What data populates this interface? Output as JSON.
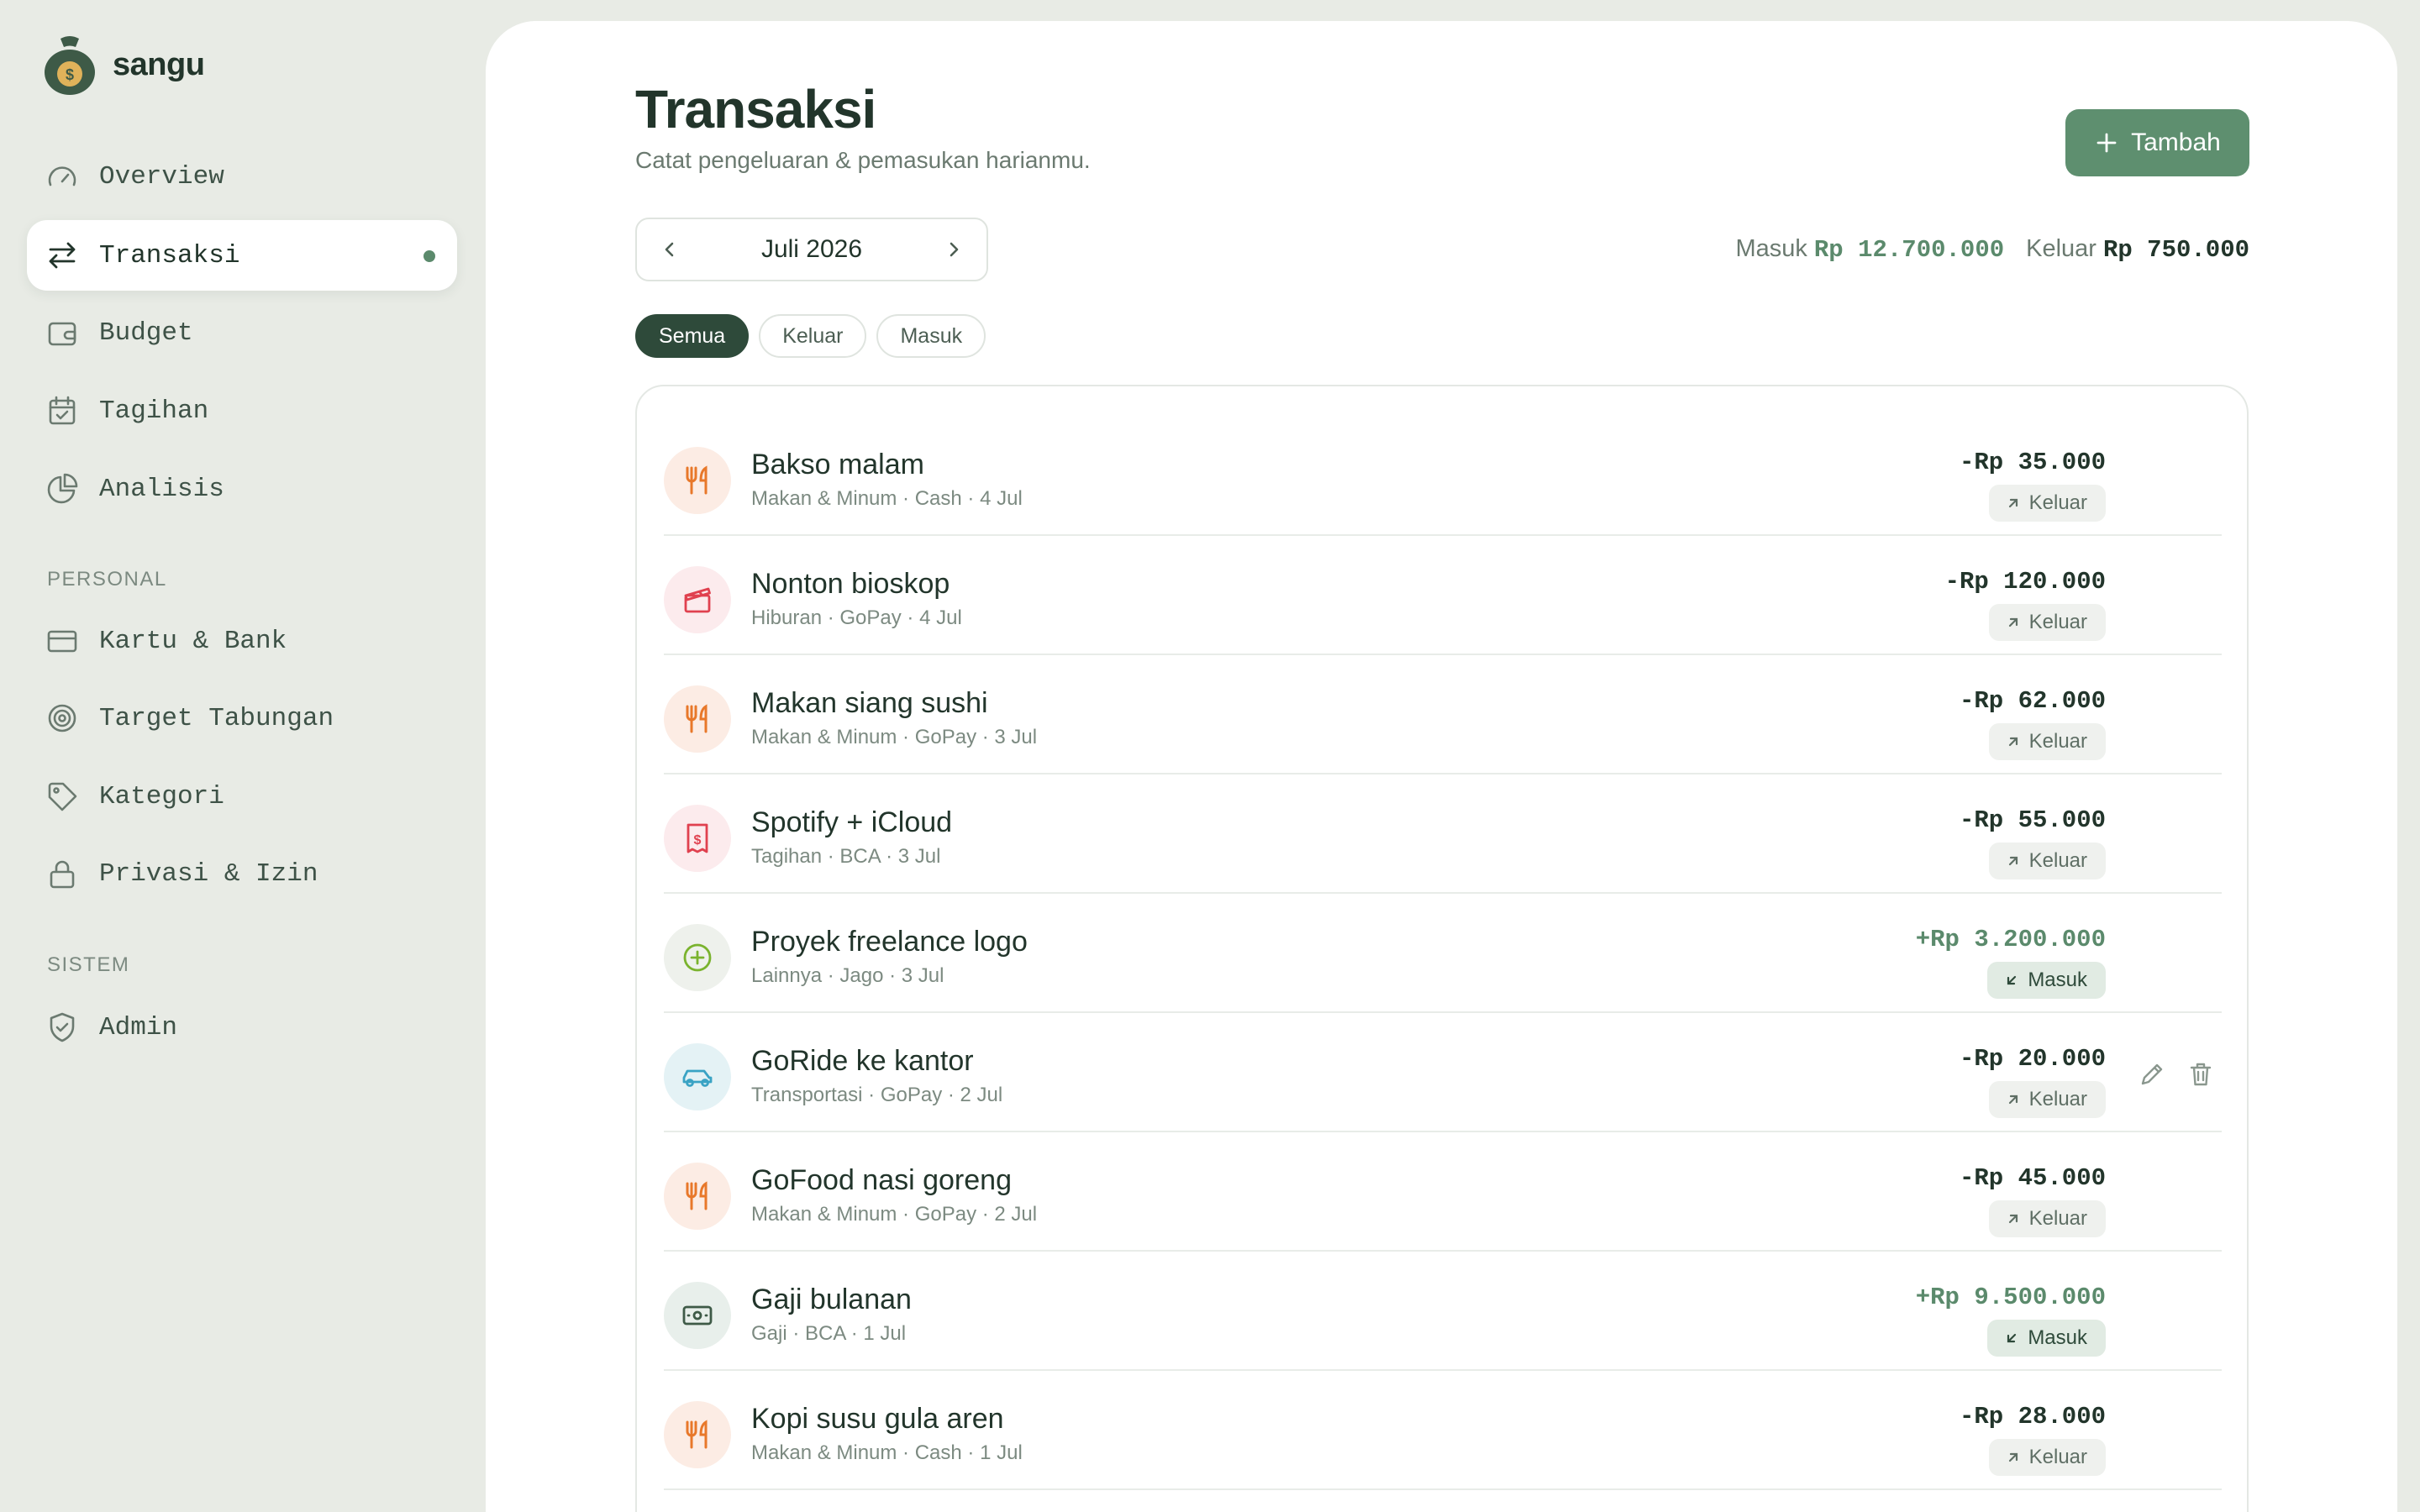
{
  "app": {
    "name": "sangu"
  },
  "sidebar": {
    "nav": [
      {
        "label": "Overview",
        "icon": "gauge-icon"
      },
      {
        "label": "Transaksi",
        "icon": "swap-arrows-icon",
        "active": true
      },
      {
        "label": "Budget",
        "icon": "wallet-icon"
      },
      {
        "label": "Tagihan",
        "icon": "calendar-check-icon"
      },
      {
        "label": "Analisis",
        "icon": "pie-chart-icon"
      }
    ],
    "personal_label": "PERSONAL",
    "personal": [
      {
        "label": "Kartu & Bank",
        "icon": "credit-card-icon"
      },
      {
        "label": "Target Tabungan",
        "icon": "target-icon"
      },
      {
        "label": "Kategori",
        "icon": "tag-icon"
      },
      {
        "label": "Privasi & Izin",
        "icon": "lock-icon"
      }
    ],
    "system_label": "SISTEM",
    "system": [
      {
        "label": "Admin",
        "icon": "shield-check-icon"
      }
    ]
  },
  "header": {
    "title": "Transaksi",
    "subtitle": "Catat pengeluaran & pemasukan harianmu.",
    "add_label": "Tambah"
  },
  "period": {
    "label": "Juli 2026"
  },
  "totals": {
    "in_label": "Masuk",
    "in_value": "Rp 12.700.000",
    "out_label": "Keluar",
    "out_value": "Rp 750.000"
  },
  "filters": [
    "Semua",
    "Keluar",
    "Masuk"
  ],
  "colors": {
    "accent": "#5e8f6f",
    "dark": "#2e4a3a",
    "food": "#e8782a",
    "fun": "#e0414f",
    "transport": "#3aa3c4",
    "other": "#7ab32e"
  },
  "transactions": [
    {
      "title": "Bakso malam",
      "meta": "Makan & Minum · Cash · 4 Jul",
      "amount": "-Rp 35.000",
      "type": "Keluar",
      "kind": "food"
    },
    {
      "title": "Nonton bioskop",
      "meta": "Hiburan · GoPay · 4 Jul",
      "amount": "-Rp 120.000",
      "type": "Keluar",
      "kind": "fun"
    },
    {
      "title": "Makan siang sushi",
      "meta": "Makan & Minum · GoPay · 3 Jul",
      "amount": "-Rp 62.000",
      "type": "Keluar",
      "kind": "food"
    },
    {
      "title": "Spotify + iCloud",
      "meta": "Tagihan · BCA · 3 Jul",
      "amount": "-Rp 55.000",
      "type": "Keluar",
      "kind": "bill"
    },
    {
      "title": "Proyek freelance logo",
      "meta": "Lainnya · Jago · 3 Jul",
      "amount": "+Rp 3.200.000",
      "type": "Masuk",
      "kind": "other"
    },
    {
      "title": "GoRide ke kantor",
      "meta": "Transportasi · GoPay · 2 Jul",
      "amount": "-Rp 20.000",
      "type": "Keluar",
      "kind": "transport",
      "hover": true
    },
    {
      "title": "GoFood nasi goreng",
      "meta": "Makan & Minum · GoPay · 2 Jul",
      "amount": "-Rp 45.000",
      "type": "Keluar",
      "kind": "food"
    },
    {
      "title": "Gaji bulanan",
      "meta": "Gaji · BCA · 1 Jul",
      "amount": "+Rp 9.500.000",
      "type": "Masuk",
      "kind": "salary"
    },
    {
      "title": "Kopi susu gula aren",
      "meta": "Makan & Minum · Cash · 1 Jul",
      "amount": "-Rp 28.000",
      "type": "Keluar",
      "kind": "food"
    }
  ]
}
